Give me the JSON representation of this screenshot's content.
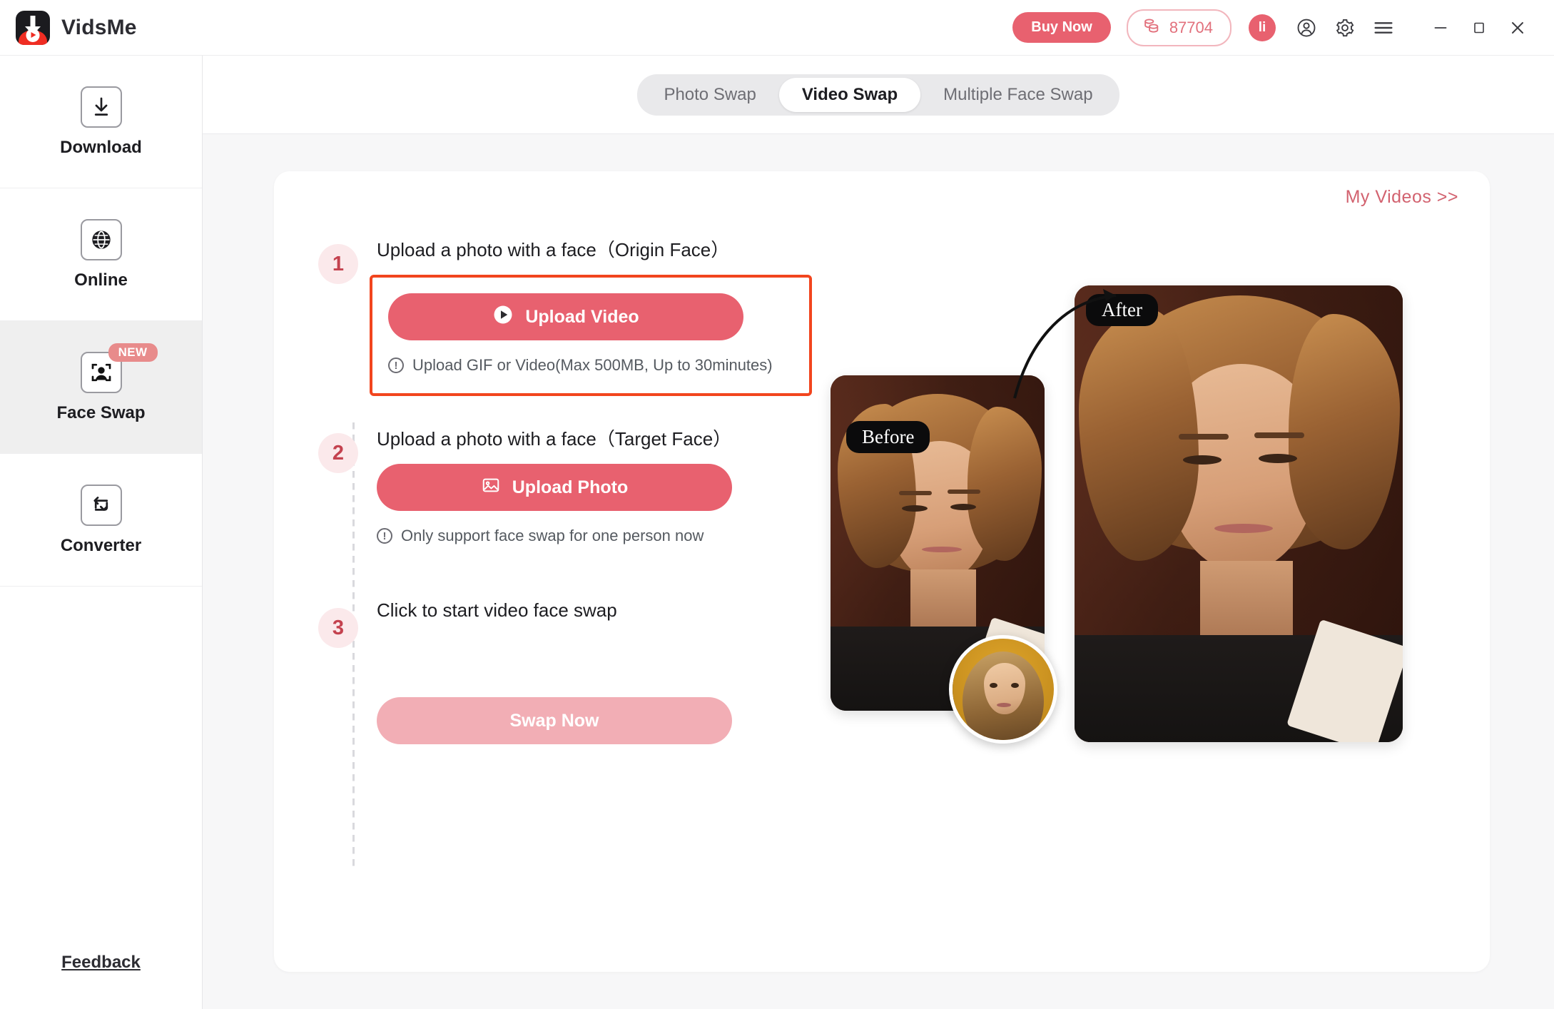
{
  "app": {
    "brand_name": "VidsMe",
    "logo_icon": "vidsme-logo-icon"
  },
  "titlebar": {
    "buy_now_label": "Buy Now",
    "credits_value": "87704",
    "credits_icon": "coins-icon",
    "avatar_initials": "li",
    "account_icon": "user-circle-icon",
    "settings_icon": "gear-icon",
    "menu_icon": "hamburger-menu-icon",
    "minimize_icon": "minimize-icon",
    "maximize_icon": "maximize-icon",
    "close_icon": "close-icon",
    "accent_color": "#e8616f"
  },
  "sidebar": {
    "items": [
      {
        "label": "Download",
        "icon": "download-icon",
        "active": false,
        "badge": ""
      },
      {
        "label": "Online",
        "icon": "globe-icon",
        "active": false,
        "badge": ""
      },
      {
        "label": "Face Swap",
        "icon": "face-detect-icon",
        "active": true,
        "badge": "NEW"
      },
      {
        "label": "Converter",
        "icon": "convert-loop-icon",
        "active": false,
        "badge": ""
      }
    ],
    "feedback_label": "Feedback"
  },
  "tabs": [
    {
      "label": "Photo Swap",
      "active": false
    },
    {
      "label": "Video Swap",
      "active": true
    },
    {
      "label": "Multiple Face Swap",
      "active": false
    }
  ],
  "card": {
    "my_videos_label": "My Videos >>"
  },
  "steps": [
    {
      "number": "1",
      "title": "Upload a photo with a face（Origin Face）",
      "button_label": "Upload Video",
      "button_icon": "play-circle-icon",
      "hint": "Upload GIF or Video(Max 500MB, Up to 30minutes)",
      "hint_icon": "info-icon",
      "highlighted": true
    },
    {
      "number": "2",
      "title": "Upload a photo with a face（Target Face）",
      "button_label": "Upload Photo",
      "button_icon": "image-icon",
      "hint": "Only support face swap for one person now",
      "hint_icon": "info-icon",
      "highlighted": false
    },
    {
      "number": "3",
      "title": "Click to start video face swap",
      "button_label": "Swap Now",
      "button_icon": "",
      "hint": "",
      "hint_icon": "",
      "highlighted": false,
      "disabled": true
    }
  ],
  "preview": {
    "before_label": "Before",
    "after_label": "After",
    "thumb_name": "target-face-thumbnail",
    "arrow_name": "before-to-after-arrow"
  },
  "colors": {
    "accent": "#e8616f",
    "accent_disabled": "#f2aeb5",
    "highlight_border": "#f2451e",
    "link": "#d2626f",
    "badge": "#e88b8b",
    "page_bg": "#f7f7f8"
  }
}
